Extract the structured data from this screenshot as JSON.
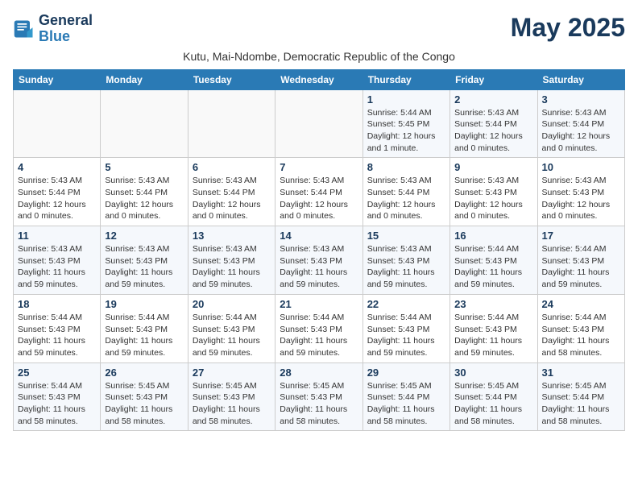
{
  "logo": {
    "text_general": "General",
    "text_blue": "Blue"
  },
  "header": {
    "month_year": "May 2025",
    "location": "Kutu, Mai-Ndombe, Democratic Republic of the Congo"
  },
  "weekdays": [
    "Sunday",
    "Monday",
    "Tuesday",
    "Wednesday",
    "Thursday",
    "Friday",
    "Saturday"
  ],
  "weeks": [
    [
      {
        "day": "",
        "info": ""
      },
      {
        "day": "",
        "info": ""
      },
      {
        "day": "",
        "info": ""
      },
      {
        "day": "",
        "info": ""
      },
      {
        "day": "1",
        "info": "Sunrise: 5:44 AM\nSunset: 5:45 PM\nDaylight: 12 hours and 1 minute."
      },
      {
        "day": "2",
        "info": "Sunrise: 5:43 AM\nSunset: 5:44 PM\nDaylight: 12 hours and 0 minutes."
      },
      {
        "day": "3",
        "info": "Sunrise: 5:43 AM\nSunset: 5:44 PM\nDaylight: 12 hours and 0 minutes."
      }
    ],
    [
      {
        "day": "4",
        "info": "Sunrise: 5:43 AM\nSunset: 5:44 PM\nDaylight: 12 hours and 0 minutes."
      },
      {
        "day": "5",
        "info": "Sunrise: 5:43 AM\nSunset: 5:44 PM\nDaylight: 12 hours and 0 minutes."
      },
      {
        "day": "6",
        "info": "Sunrise: 5:43 AM\nSunset: 5:44 PM\nDaylight: 12 hours and 0 minutes."
      },
      {
        "day": "7",
        "info": "Sunrise: 5:43 AM\nSunset: 5:44 PM\nDaylight: 12 hours and 0 minutes."
      },
      {
        "day": "8",
        "info": "Sunrise: 5:43 AM\nSunset: 5:44 PM\nDaylight: 12 hours and 0 minutes."
      },
      {
        "day": "9",
        "info": "Sunrise: 5:43 AM\nSunset: 5:43 PM\nDaylight: 12 hours and 0 minutes."
      },
      {
        "day": "10",
        "info": "Sunrise: 5:43 AM\nSunset: 5:43 PM\nDaylight: 12 hours and 0 minutes."
      }
    ],
    [
      {
        "day": "11",
        "info": "Sunrise: 5:43 AM\nSunset: 5:43 PM\nDaylight: 11 hours and 59 minutes."
      },
      {
        "day": "12",
        "info": "Sunrise: 5:43 AM\nSunset: 5:43 PM\nDaylight: 11 hours and 59 minutes."
      },
      {
        "day": "13",
        "info": "Sunrise: 5:43 AM\nSunset: 5:43 PM\nDaylight: 11 hours and 59 minutes."
      },
      {
        "day": "14",
        "info": "Sunrise: 5:43 AM\nSunset: 5:43 PM\nDaylight: 11 hours and 59 minutes."
      },
      {
        "day": "15",
        "info": "Sunrise: 5:43 AM\nSunset: 5:43 PM\nDaylight: 11 hours and 59 minutes."
      },
      {
        "day": "16",
        "info": "Sunrise: 5:44 AM\nSunset: 5:43 PM\nDaylight: 11 hours and 59 minutes."
      },
      {
        "day": "17",
        "info": "Sunrise: 5:44 AM\nSunset: 5:43 PM\nDaylight: 11 hours and 59 minutes."
      }
    ],
    [
      {
        "day": "18",
        "info": "Sunrise: 5:44 AM\nSunset: 5:43 PM\nDaylight: 11 hours and 59 minutes."
      },
      {
        "day": "19",
        "info": "Sunrise: 5:44 AM\nSunset: 5:43 PM\nDaylight: 11 hours and 59 minutes."
      },
      {
        "day": "20",
        "info": "Sunrise: 5:44 AM\nSunset: 5:43 PM\nDaylight: 11 hours and 59 minutes."
      },
      {
        "day": "21",
        "info": "Sunrise: 5:44 AM\nSunset: 5:43 PM\nDaylight: 11 hours and 59 minutes."
      },
      {
        "day": "22",
        "info": "Sunrise: 5:44 AM\nSunset: 5:43 PM\nDaylight: 11 hours and 59 minutes."
      },
      {
        "day": "23",
        "info": "Sunrise: 5:44 AM\nSunset: 5:43 PM\nDaylight: 11 hours and 59 minutes."
      },
      {
        "day": "24",
        "info": "Sunrise: 5:44 AM\nSunset: 5:43 PM\nDaylight: 11 hours and 58 minutes."
      }
    ],
    [
      {
        "day": "25",
        "info": "Sunrise: 5:44 AM\nSunset: 5:43 PM\nDaylight: 11 hours and 58 minutes."
      },
      {
        "day": "26",
        "info": "Sunrise: 5:45 AM\nSunset: 5:43 PM\nDaylight: 11 hours and 58 minutes."
      },
      {
        "day": "27",
        "info": "Sunrise: 5:45 AM\nSunset: 5:43 PM\nDaylight: 11 hours and 58 minutes."
      },
      {
        "day": "28",
        "info": "Sunrise: 5:45 AM\nSunset: 5:43 PM\nDaylight: 11 hours and 58 minutes."
      },
      {
        "day": "29",
        "info": "Sunrise: 5:45 AM\nSunset: 5:44 PM\nDaylight: 11 hours and 58 minutes."
      },
      {
        "day": "30",
        "info": "Sunrise: 5:45 AM\nSunset: 5:44 PM\nDaylight: 11 hours and 58 minutes."
      },
      {
        "day": "31",
        "info": "Sunrise: 5:45 AM\nSunset: 5:44 PM\nDaylight: 11 hours and 58 minutes."
      }
    ]
  ]
}
